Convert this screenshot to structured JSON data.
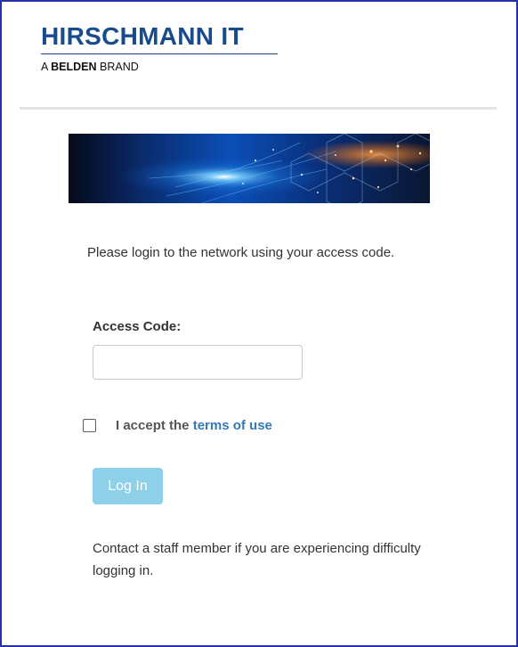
{
  "brand": {
    "title": "HIRSCHMANN IT",
    "sub_prefix": "A",
    "sub_bold": "BELDEN",
    "sub_suffix": "BRAND"
  },
  "intro_text": "Please login to the network using your access code.",
  "form": {
    "access_code_label": "Access Code:",
    "access_code_value": "",
    "terms_prefix": "I accept the",
    "terms_link": "terms of use",
    "terms_checked": false,
    "login_button": "Log In"
  },
  "help_text": "Contact a staff member if you are experiencing difficulty logging in.",
  "colors": {
    "frame": "#2431a8",
    "brand": "#174b8c",
    "link": "#337ab7",
    "button": "#8ed0e8"
  },
  "icons": [
    "checkbox-icon"
  ]
}
